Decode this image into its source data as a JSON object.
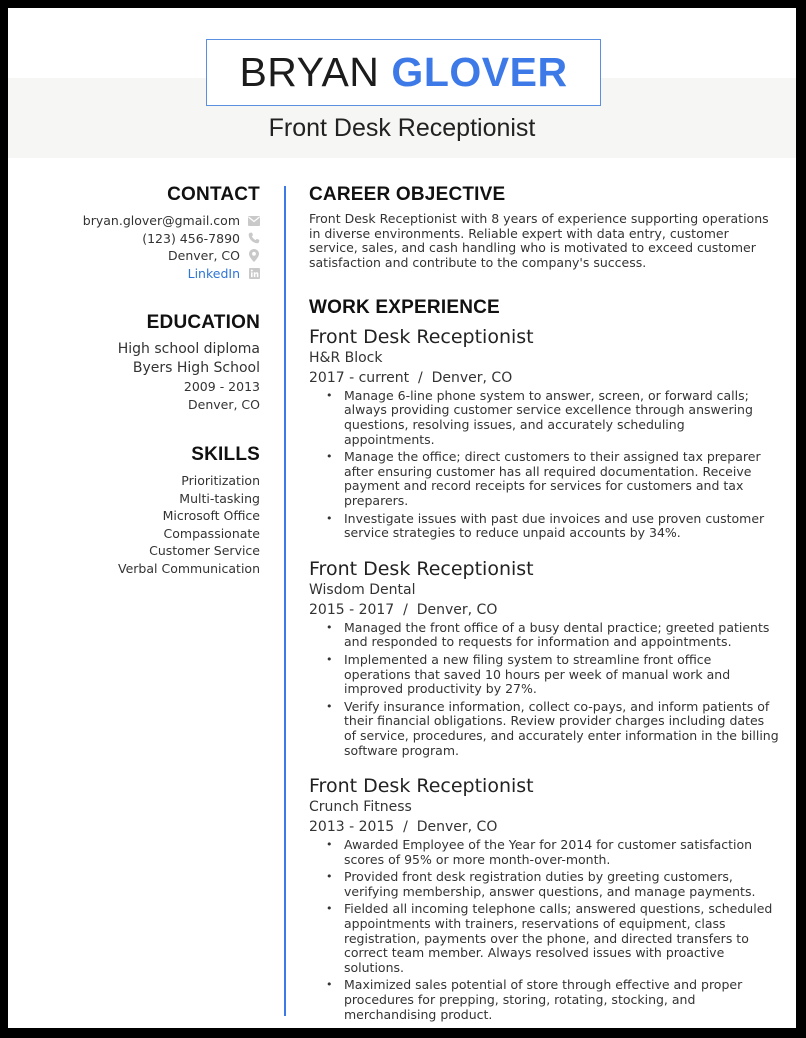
{
  "header": {
    "first_name": "BRYAN",
    "last_name": "GLOVER",
    "title": "Front Desk Receptionist",
    "accent_color": "#3d7ae8"
  },
  "contact": {
    "heading": "CONTACT",
    "items": [
      {
        "text": "bryan.glover@gmail.com",
        "icon": "envelope-icon"
      },
      {
        "text": "(123) 456-7890",
        "icon": "phone-icon"
      },
      {
        "text": "Denver, CO",
        "icon": "map-pin-icon"
      },
      {
        "text": "LinkedIn",
        "icon": "linkedin-icon"
      }
    ]
  },
  "education": {
    "heading": "EDUCATION",
    "degree": "High school diploma",
    "school": "Byers High School",
    "years": "2009 - 2013",
    "location": "Denver, CO"
  },
  "skills": {
    "heading": "SKILLS",
    "items": [
      "Prioritization",
      "Multi-tasking",
      "Microsoft Office",
      "Compassionate",
      "Customer Service",
      "Verbal Communication"
    ]
  },
  "objective": {
    "heading": "CAREER OBJECTIVE",
    "text": "Front Desk Receptionist with 8 years of experience supporting operations in diverse environments. Reliable expert with data entry, customer service, sales, and cash handling who is motivated to exceed customer satisfaction and contribute to the company's success."
  },
  "work": {
    "heading": "WORK EXPERIENCE",
    "jobs": [
      {
        "role": "Front Desk Receptionist",
        "company": "H&R Block",
        "meta": "2017 - current  /  Denver, CO",
        "bullets": [
          "Manage 6-line phone system to answer, screen, or forward calls; always providing customer service excellence through answering questions, resolving issues, and accurately scheduling appointments.",
          "Manage the office; direct customers to their assigned tax preparer after ensuring customer has all required documentation. Receive payment and record receipts for services for customers and tax preparers.",
          "Investigate issues with past due invoices and use proven customer service strategies to reduce unpaid accounts by 34%."
        ]
      },
      {
        "role": "Front Desk Receptionist",
        "company": "Wisdom Dental",
        "meta": "2015 - 2017  /  Denver, CO",
        "bullets": [
          "Managed the front office of a busy dental practice; greeted patients and responded to requests for information and appointments.",
          "Implemented a new filing system to streamline front office operations that saved 10 hours per week of manual work and improved productivity by 27%.",
          "Verify insurance information, collect co-pays, and inform patients of their financial obligations. Review provider charges including dates of service, procedures, and accurately enter information in the billing software program."
        ]
      },
      {
        "role": "Front Desk Receptionist",
        "company": "Crunch Fitness",
        "meta": "2013 - 2015  /  Denver, CO",
        "bullets": [
          "Awarded Employee of the Year for 2014 for customer satisfaction scores of 95% or more month-over-month.",
          "Provided front desk registration duties by greeting customers, verifying membership, answer questions, and manage payments.",
          "Fielded all incoming telephone calls; answered questions, scheduled appointments with trainers, reservations of equipment, class registration, payments over the phone, and directed transfers to correct team member. Always resolved issues with proactive solutions.",
          "Maximized sales potential of store through effective and proper procedures for prepping, storing, rotating, stocking, and merchandising product."
        ]
      }
    ]
  }
}
